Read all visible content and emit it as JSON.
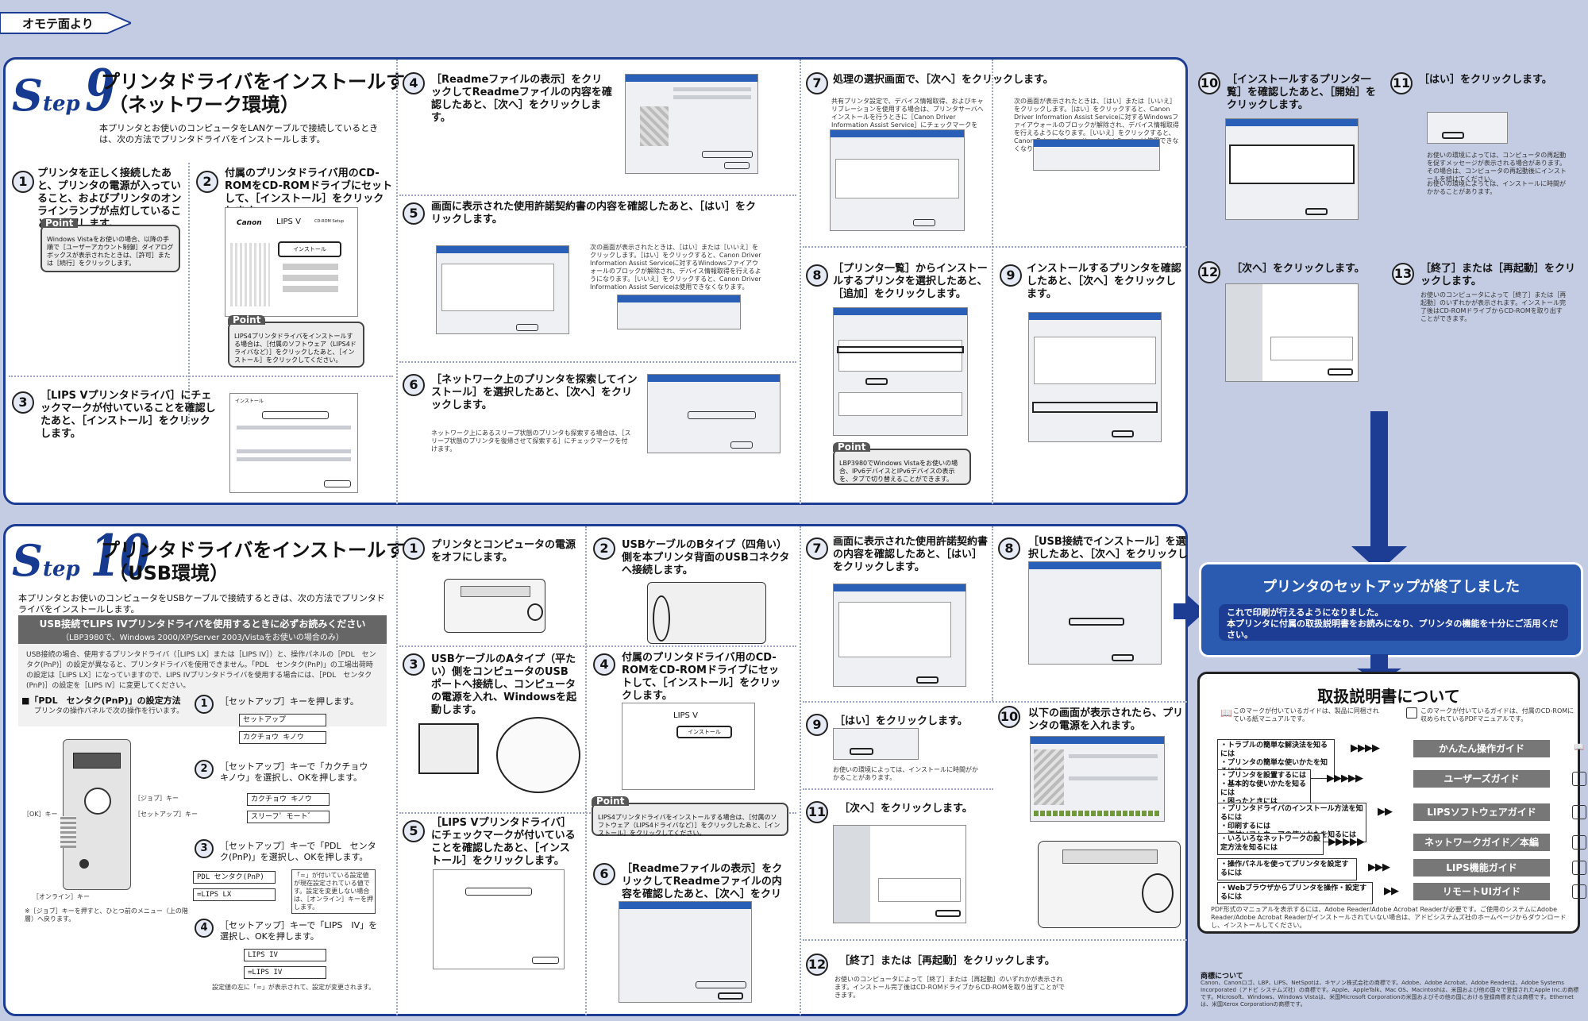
{
  "tag": {
    "label": "オモテ面より"
  },
  "step9": {
    "logo_s": "S",
    "logo_tep": "tep",
    "logo_num": "9",
    "title1": "プリンタドライバをインストールする",
    "title2": "（ネットワーク環境）",
    "intro": "本プリンタとお使いのコンピュータをLANケーブルで接続しているときは、次の方法でプリンタドライバをインストールします。",
    "s1": {
      "num": "1",
      "text": "プリンタを正しく接続したあと、プリンタの電源が入っていること、およびプリンタのオンラインランプが点灯していることを確認します。"
    },
    "s1point": {
      "label": "Point",
      "text": "Windows Vistaをお使いの場合、以降の手順で［ユーザーアカウント制御］ダイアログボックスが表示されたときは、［許可］または［続行］をクリックします。"
    },
    "s2": {
      "num": "2",
      "text": "付属のプリンタドライバ用のCD-ROMをCD-ROMドライブにセットして、［インストール］をクリックします。"
    },
    "s2point": {
      "label": "Point",
      "text": "LIPS4プリンタドライバをインストールする場合は、［付属のソフトウェア（LIPS4ドライバなど）］をクリックしたあと、［インストール］をクリックしてください。"
    },
    "s2shot": {
      "brand": "Canon",
      "product": "LIPS V",
      "setup": "CD-ROM Setup",
      "install": "インストール"
    },
    "s3": {
      "num": "3",
      "text": "［LIPS Vプリンタドライバ］にチェックマークが付いていることを確認したあと、［インストール］をクリックします。"
    },
    "s3shot": {
      "title": "インストール"
    },
    "s4": {
      "num": "4",
      "text": "［Readmeファイルの表示］をクリックしてReadmeファイルの内容を確認したあと、［次へ］をクリックします。"
    },
    "s5": {
      "num": "5",
      "text": "画面に表示された使用許諾契約書の内容を確認したあと、［はい］をクリックします。",
      "note": "次の画面が表示されたときは、［はい］または［いいえ］をクリックします。［はい］をクリックすると、Canon Driver Information Assist Serviceに対するWindowsファイアウォールのブロックが解除され、デバイス情報取得を行えるようになります。［いいえ］をクリックすると、Canon Driver Information Assist Serviceは使用できなくなります。"
    },
    "s6": {
      "num": "6",
      "text": "［ネットワーク上のプリンタを探索してインストール］を選択したあと、［次へ］をクリックします。",
      "note": "ネットワーク上にあるスリープ状態のプリンタも探索する場合は、［スリープ状態のプリンタを復帰させて探索する］にチェックマークを付けます。"
    },
    "s7": {
      "num": "7",
      "text": "処理の選択画面で、［次へ］をクリックします。",
      "note1": "共有プリンタ設定で、デバイス情報取得、およびキャリブレーションを使用する場合は、プリンタサーバへインストールを行うときに［Canon Driver Information Assist Service］にチェックマークを付けます。",
      "note2": "次の画面が表示されたときは、［はい］または［いいえ］をクリックします。［はい］をクリックすると、Canon Driver Information Assist Serviceに対するWindowsファイアウォールのブロックが解除され、デバイス情報取得を行えるようになります。［いいえ］をクリックすると、Canon Driver Information Assist Serviceは使用できなくなります。"
    },
    "s8": {
      "num": "8",
      "text": "［プリンタ一覧］からインストールするプリンタを選択したあと、［追加］をクリックします。"
    },
    "s8point": {
      "label": "Point",
      "text": "LBP3980でWindows Vistaをお使いの場合、IPv6デバイスとIPv6デバイスの表示を、タブで切り替えることができます。"
    },
    "s9": {
      "num": "9",
      "text": "インストールするプリンタを確認したあと、［次へ］をクリックします。"
    },
    "s10": {
      "num": "10",
      "text": "［インストールするプリンタ一覧］を確認したあと、［開始］をクリックします。"
    },
    "s11": {
      "num": "11",
      "text": "［はい］をクリックします。",
      "note1": "お使いの環境によっては、コンピュータの再起動を促すメッセージが表示される場合があります。その場合は、コンピュータの再起動後にインストールを続けてください。",
      "note2": "お使いの環境によっては、インストールに時間がかかることがあります。"
    },
    "s12": {
      "num": "12",
      "text": "［次へ］をクリックします。"
    },
    "s13": {
      "num": "13",
      "text": "［終了］または［再起動］をクリックします。",
      "note": "お使いのコンピュータによって［終了］または［再起動］のいずれかが表示されます。インストール完了後はCD-ROMドライブからCD-ROMを取り出すことができます。"
    }
  },
  "step10": {
    "logo_s": "S",
    "logo_tep": "tep",
    "logo_num": "10",
    "title1": "プリンタドライバをインストールする",
    "title2": "（USB環境）",
    "intro": "本プリンタとお使いのコンピュータをUSBケーブルで接続するときは、次の方法でプリンタドライバをインストールします。",
    "warn_title": "USB接続でLIPS IVプリンタドライバを使用するときに必ずお読みください",
    "warn_sub": "（LBP3980で、Windows 2000/XP/Server 2003/Vistaをお使いの場合のみ）",
    "warn_text": "USB接続の場合、使用するプリンタドライバ（［LIPS LX］または［LIPS IV］）と、操作パネルの［PDL　センタク(PnP)］の設定が異なると、プリンタドライバを使用できません。「PDL　センタク(PnP)」の工場出荷時の設定は［LIPS LX］になっていますので、LIPS IVプリンタドライバを使用する場合には、［PDL　センタク(PnP)］の設定を［LIPS IV］に変更してください。",
    "pdl_title": "■「PDL　センタク(PnP)」の設定方法",
    "pdl_sub": "プリンタの操作パネルで次の操作を行います。",
    "panel_labels": {
      "job": "［ジョブ］キー",
      "setup": "［セットアップ］キー",
      "ok": "［OK］キー",
      "online": "［オンライン］キー"
    },
    "panel_note": "※［ジョブ］キーを押すと、ひとつ前のメニュー（上の階層）へ戻ります。",
    "p1": {
      "num": "1",
      "text": "［セットアップ］キーを押します。",
      "lcd1": "セットアップ",
      "lcd2": "カクチョウ キノウ"
    },
    "p2": {
      "num": "2",
      "text": "［セットアップ］キーで「カクチョウ　キノウ」を選択し、OKを押します。",
      "lcd1": "カクチョウ キノウ",
      "lcd2": "スリーフ゜モート゛"
    },
    "p3": {
      "num": "3",
      "text": "［セットアップ］キーで「PDL　センタク(PnP)」を選択し、OKを押します。",
      "lcd1": "PDL センタク(PnP)",
      "lcd2": "=LIPS LX",
      "note": "「=」が付いている設定値が現在設定されている値です。設定を変更しない場合は、［オンライン］キーを押します。"
    },
    "p4": {
      "num": "4",
      "text": "［セットアップ］キーで「LIPS　IV」を選択し、OKを押します。",
      "lcd1": "LIPS IV",
      "lcd2": "=LIPS IV",
      "note": "設定値の左に「=」が表示されて、設定が変更されます。"
    },
    "s1": {
      "num": "1",
      "text": "プリンタとコンピュータの電源をオフにします。"
    },
    "s2": {
      "num": "2",
      "text": "USBケーブルのBタイプ（四角い）側を本プリンタ背面のUSBコネクタへ接続します。"
    },
    "s3": {
      "num": "3",
      "text": "USBケーブルのAタイプ（平たい）側をコンピュータのUSBポートへ接続し、コンピュータの電源を入れ、Windowsを起動します。"
    },
    "s4": {
      "num": "4",
      "text": "付属のプリンタドライバ用のCD-ROMをCD-ROMドライブにセットして、［インストール］をクリックします。"
    },
    "s4point": {
      "label": "Point",
      "text": "LIPS4プリンタドライバをインストールする場合は、［付属のソフトウェア（LIPS4ドライバなど）］をクリックしたあと、［インストール］をクリックしてください。"
    },
    "s5": {
      "num": "5",
      "text": "［LIPS Vプリンタドライバ］にチェックマークが付いていることを確認したあと、［インストール］をクリックします。"
    },
    "s6": {
      "num": "6",
      "text": "［Readmeファイルの表示］をクリックしてReadmeファイルの内容を確認したあと、［次へ］をクリックします。"
    },
    "s7": {
      "num": "7",
      "text": "画面に表示された使用許諾契約書の内容を確認したあと、［はい］をクリックします。"
    },
    "s8": {
      "num": "8",
      "text": "［USB接続でインストール］を選択したあと、［次へ］をクリックします。"
    },
    "s9": {
      "num": "9",
      "text": "［はい］をクリックします。",
      "note": "お使いの環境によっては、インストールに時間がかかることがあります。"
    },
    "s10": {
      "num": "10",
      "text": "以下の画面が表示されたら、プリンタの電源を入れます。"
    },
    "s11": {
      "num": "11",
      "text": "［次へ］をクリックします。"
    },
    "s12": {
      "num": "12",
      "text": "［終了］または［再起動］をクリックします。",
      "note": "お使いのコンピュータによって［終了］または［再起動］のいずれかが表示されます。インストール完了後はCD-ROMドライブからCD-ROMを取り出すことができます。"
    }
  },
  "finish": {
    "title": "プリンタのセットアップが終了しました",
    "line1": "これで印刷が行えるようになりました。",
    "line2": "本プリンタに付属の取扱説明書をお読みになり、プリンタの機能を十分にご活用ください。"
  },
  "manuals": {
    "title": "取扱説明書について",
    "legend_book": "このマークが付いているガイドは、製品に同梱されている紙マニュアルです。",
    "legend_pdf": "このマークが付いているガイドは、付属のCD-ROMに収められているPDFマニュアルです。",
    "rows": [
      {
        "text": "・トラブルの簡単な解決法を知るには\n・プリンタの簡単な使いかたを知るには",
        "arrows": "▶▶▶▶",
        "guide": "かんたん操作ガイド",
        "icon": "book"
      },
      {
        "text": "・プリンタを設置するには\n・基本的な使いかたを知るには\n・困ったときには",
        "arrows": "▶▶▶▶▶",
        "guide": "ユーザーズガイド",
        "icon": "pdf"
      },
      {
        "text": "・プリンタドライバのインストール方法を知るには\n・印刷するには\n・添付ソフトウェアの使いかたを知るには",
        "arrows": "▶▶",
        "guide": "LIPSソフトウェアガイド",
        "icon": "pdf"
      },
      {
        "text": "・いろいろなネットワークの設定方法を知るには",
        "arrows": "▶▶▶▶▶",
        "guide": "ネットワークガイド／本編",
        "icon": "pdf"
      },
      {
        "text": "・操作パネルを使ってプリンタを設定するには",
        "arrows": "▶▶▶",
        "guide": "LIPS機能ガイド",
        "icon": "pdf"
      },
      {
        "text": "・Webブラウザからプリンタを操作・設定するには",
        "arrows": "▶▶",
        "guide": "リモートUIガイド",
        "icon": "pdf"
      }
    ],
    "pdf_note": "PDF形式のマニュアルを表示するには、Adobe Reader/Adobe Acrobat Readerが必要です。ご使用のシステムにAdobe Reader/Adobe Acrobat Readerがインストールされていない場合は、アドビシステムズ社のホームページからダウンロードし、インストールしてください。"
  },
  "trademark": {
    "title": "商標について",
    "text": "Canon、Canonロゴ、LBP、LIPS、NetSpotは、キヤノン株式会社の商標です。Adobe、Adobe Acrobat、Adobe Readerは、Adobe Systems Incorporated（アドビ システムズ社）の商標です。Apple、AppleTalk、Mac OS、Macintoshは、米国および他の国々で登録されたApple Inc.の商標です。Microsoft、Windows、Windows Vistaは、米国Microsoft Corporationの米国およびその他の国における登録商標または商標です。Ethernet は、米国Xerox Corporationの商標です。"
  },
  "colors": {
    "brand": "#1d3c94",
    "finish_bg": "#2b5bb0",
    "bg": "#c4cce3"
  }
}
